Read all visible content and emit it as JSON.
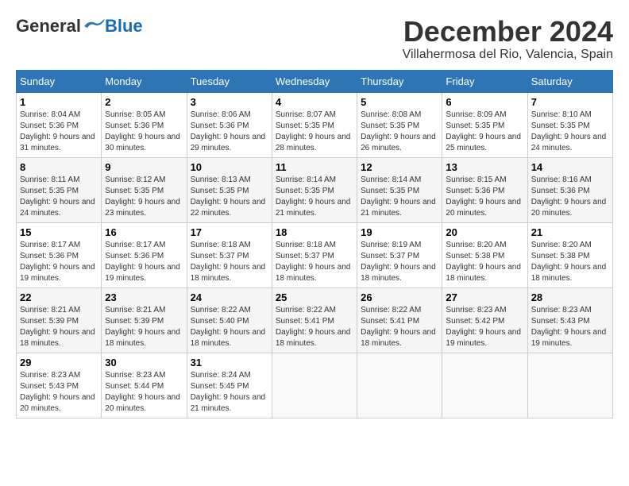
{
  "header": {
    "logo_general": "General",
    "logo_blue": "Blue",
    "month_title": "December 2024",
    "location": "Villahermosa del Rio, Valencia, Spain"
  },
  "weekdays": [
    "Sunday",
    "Monday",
    "Tuesday",
    "Wednesday",
    "Thursday",
    "Friday",
    "Saturday"
  ],
  "weeks": [
    [
      {
        "day": "1",
        "sunrise": "8:04 AM",
        "sunset": "5:36 PM",
        "daylight": "9 hours and 31 minutes."
      },
      {
        "day": "2",
        "sunrise": "8:05 AM",
        "sunset": "5:36 PM",
        "daylight": "9 hours and 30 minutes."
      },
      {
        "day": "3",
        "sunrise": "8:06 AM",
        "sunset": "5:36 PM",
        "daylight": "9 hours and 29 minutes."
      },
      {
        "day": "4",
        "sunrise": "8:07 AM",
        "sunset": "5:35 PM",
        "daylight": "9 hours and 28 minutes."
      },
      {
        "day": "5",
        "sunrise": "8:08 AM",
        "sunset": "5:35 PM",
        "daylight": "9 hours and 26 minutes."
      },
      {
        "day": "6",
        "sunrise": "8:09 AM",
        "sunset": "5:35 PM",
        "daylight": "9 hours and 25 minutes."
      },
      {
        "day": "7",
        "sunrise": "8:10 AM",
        "sunset": "5:35 PM",
        "daylight": "9 hours and 24 minutes."
      }
    ],
    [
      {
        "day": "8",
        "sunrise": "8:11 AM",
        "sunset": "5:35 PM",
        "daylight": "9 hours and 24 minutes."
      },
      {
        "day": "9",
        "sunrise": "8:12 AM",
        "sunset": "5:35 PM",
        "daylight": "9 hours and 23 minutes."
      },
      {
        "day": "10",
        "sunrise": "8:13 AM",
        "sunset": "5:35 PM",
        "daylight": "9 hours and 22 minutes."
      },
      {
        "day": "11",
        "sunrise": "8:14 AM",
        "sunset": "5:35 PM",
        "daylight": "9 hours and 21 minutes."
      },
      {
        "day": "12",
        "sunrise": "8:14 AM",
        "sunset": "5:35 PM",
        "daylight": "9 hours and 21 minutes."
      },
      {
        "day": "13",
        "sunrise": "8:15 AM",
        "sunset": "5:36 PM",
        "daylight": "9 hours and 20 minutes."
      },
      {
        "day": "14",
        "sunrise": "8:16 AM",
        "sunset": "5:36 PM",
        "daylight": "9 hours and 20 minutes."
      }
    ],
    [
      {
        "day": "15",
        "sunrise": "8:17 AM",
        "sunset": "5:36 PM",
        "daylight": "9 hours and 19 minutes."
      },
      {
        "day": "16",
        "sunrise": "8:17 AM",
        "sunset": "5:36 PM",
        "daylight": "9 hours and 19 minutes."
      },
      {
        "day": "17",
        "sunrise": "8:18 AM",
        "sunset": "5:37 PM",
        "daylight": "9 hours and 18 minutes."
      },
      {
        "day": "18",
        "sunrise": "8:18 AM",
        "sunset": "5:37 PM",
        "daylight": "9 hours and 18 minutes."
      },
      {
        "day": "19",
        "sunrise": "8:19 AM",
        "sunset": "5:37 PM",
        "daylight": "9 hours and 18 minutes."
      },
      {
        "day": "20",
        "sunrise": "8:20 AM",
        "sunset": "5:38 PM",
        "daylight": "9 hours and 18 minutes."
      },
      {
        "day": "21",
        "sunrise": "8:20 AM",
        "sunset": "5:38 PM",
        "daylight": "9 hours and 18 minutes."
      }
    ],
    [
      {
        "day": "22",
        "sunrise": "8:21 AM",
        "sunset": "5:39 PM",
        "daylight": "9 hours and 18 minutes."
      },
      {
        "day": "23",
        "sunrise": "8:21 AM",
        "sunset": "5:39 PM",
        "daylight": "9 hours and 18 minutes."
      },
      {
        "day": "24",
        "sunrise": "8:22 AM",
        "sunset": "5:40 PM",
        "daylight": "9 hours and 18 minutes."
      },
      {
        "day": "25",
        "sunrise": "8:22 AM",
        "sunset": "5:41 PM",
        "daylight": "9 hours and 18 minutes."
      },
      {
        "day": "26",
        "sunrise": "8:22 AM",
        "sunset": "5:41 PM",
        "daylight": "9 hours and 18 minutes."
      },
      {
        "day": "27",
        "sunrise": "8:23 AM",
        "sunset": "5:42 PM",
        "daylight": "9 hours and 19 minutes."
      },
      {
        "day": "28",
        "sunrise": "8:23 AM",
        "sunset": "5:43 PM",
        "daylight": "9 hours and 19 minutes."
      }
    ],
    [
      {
        "day": "29",
        "sunrise": "8:23 AM",
        "sunset": "5:43 PM",
        "daylight": "9 hours and 20 minutes."
      },
      {
        "day": "30",
        "sunrise": "8:23 AM",
        "sunset": "5:44 PM",
        "daylight": "9 hours and 20 minutes."
      },
      {
        "day": "31",
        "sunrise": "8:24 AM",
        "sunset": "5:45 PM",
        "daylight": "9 hours and 21 minutes."
      },
      null,
      null,
      null,
      null
    ]
  ],
  "labels": {
    "sunrise": "Sunrise:",
    "sunset": "Sunset:",
    "daylight": "Daylight:"
  }
}
